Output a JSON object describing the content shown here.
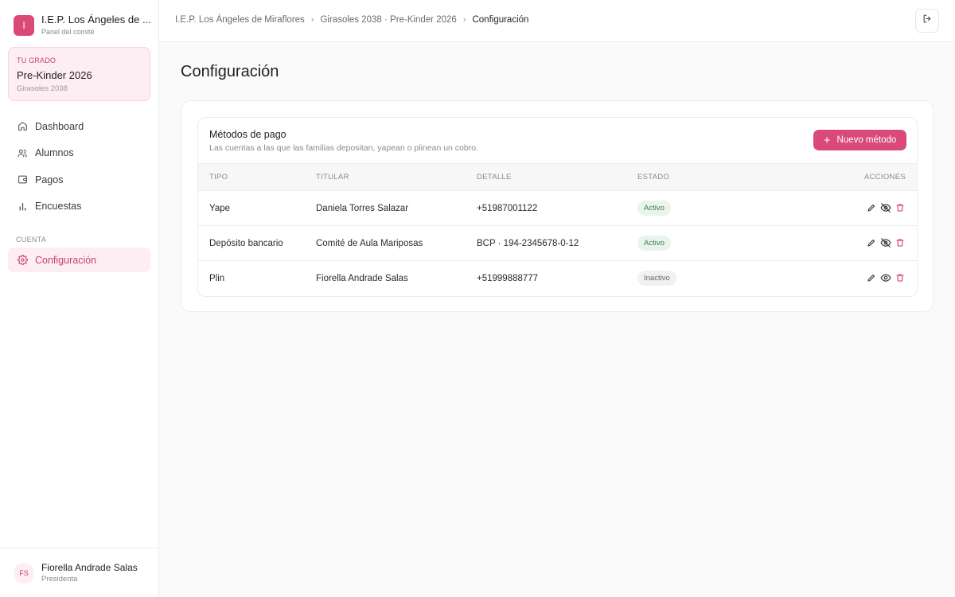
{
  "sidebar": {
    "brand": {
      "initial": "I",
      "title": "I.E.P. Los Ángeles de ...",
      "subtitle": "Panel del comité"
    },
    "grade": {
      "kicker": "TU GRADO",
      "name": "Pre-Kinder 2026",
      "sub": "Girasoles 2038"
    },
    "nav": [
      {
        "label": "Dashboard",
        "icon": "home-icon"
      },
      {
        "label": "Alumnos",
        "icon": "users-icon"
      },
      {
        "label": "Pagos",
        "icon": "wallet-icon"
      },
      {
        "label": "Encuestas",
        "icon": "bar-chart-icon"
      }
    ],
    "section": "CUENTA",
    "active": {
      "label": "Configuración",
      "icon": "gear-icon"
    },
    "user": {
      "initials": "FS",
      "name": "Fiorella Andrade Salas",
      "role": "Presidenta"
    }
  },
  "topbar": {
    "breadcrumb": [
      "I.E.P. Los Ángeles de Miraflores",
      "Girasoles 2038 · Pre-Kinder 2026",
      "Configuración"
    ]
  },
  "page": {
    "title": "Configuración"
  },
  "payment_methods": {
    "title": "Métodos de pago",
    "subtitle": "Las cuentas a las que las familias depositan, yapean o plinean un cobro.",
    "new_button": "Nuevo método",
    "columns": [
      "TIPO",
      "TITULAR",
      "DETALLE",
      "ESTADO",
      "ACCIONES"
    ],
    "rows": [
      {
        "tipo": "Yape",
        "titular": "Daniela Torres Salazar",
        "detalle": "+51987001122",
        "estado": "Activo",
        "active": true
      },
      {
        "tipo": "Depósito bancario",
        "titular": "Comité de Aula Mariposas",
        "detalle": "BCP · 194-2345678-0-12",
        "estado": "Activo",
        "active": true
      },
      {
        "tipo": "Plin",
        "titular": "Fiorella Andrade Salas",
        "detalle": "+51999888777",
        "estado": "Inactivo",
        "active": false
      }
    ]
  },
  "colors": {
    "accent": "#d94a79",
    "accent_soft": "#fdeef3",
    "active_badge": "#e8f4ec",
    "delete": "#d6336c"
  }
}
